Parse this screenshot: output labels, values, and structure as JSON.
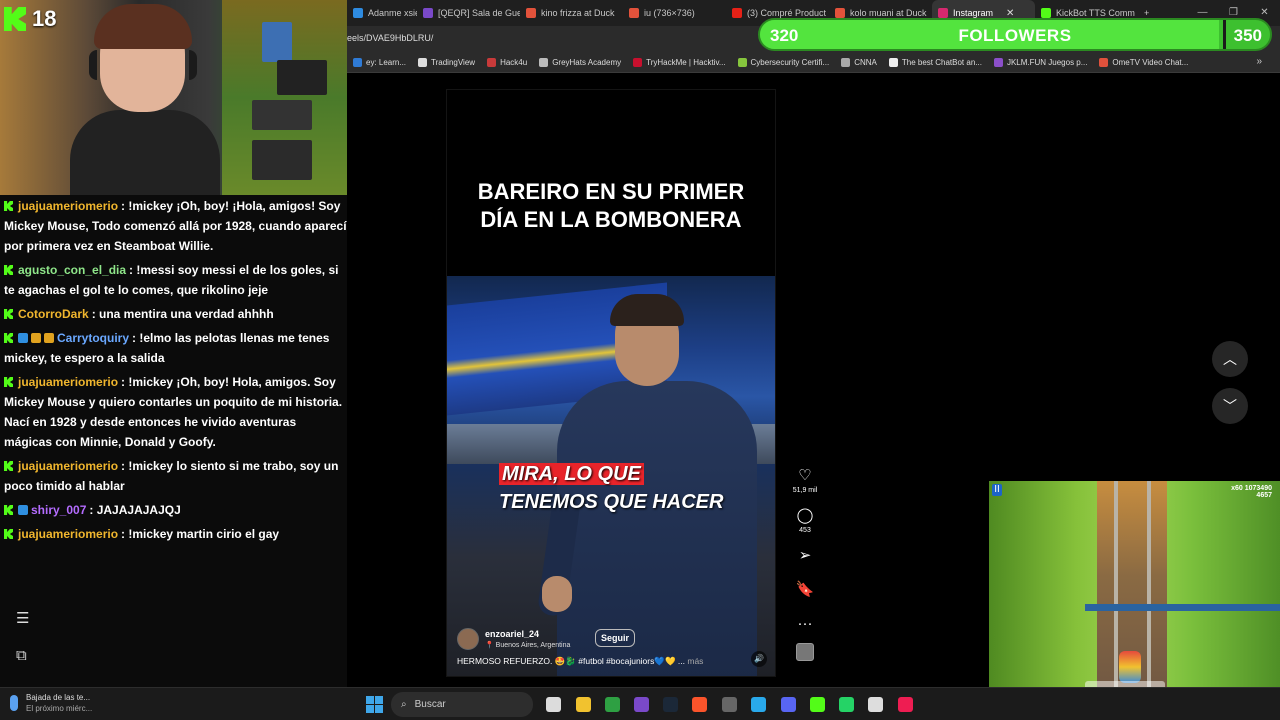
{
  "stream": {
    "viewer_count": "18",
    "followers_goal": {
      "min": "320",
      "title": "FOLLOWERS",
      "max": "350",
      "progress": 0.9
    }
  },
  "browser": {
    "tabs": [
      {
        "label": "Adanme xsiemp",
        "color": "#2e8be0",
        "active": false
      },
      {
        "label": "[QEQR] Sala de Gue",
        "color": "#7a49c9",
        "active": false
      },
      {
        "label": "kino frizza at Duck",
        "color": "#e2523b",
        "active": false
      },
      {
        "label": "iu (736×736)",
        "color": "#e2523b",
        "active": false
      },
      {
        "label": "(3) Compré Product",
        "color": "#e62117",
        "active": false
      },
      {
        "label": "kolo muani at Duck",
        "color": "#e2523b",
        "active": false
      },
      {
        "label": "Instagram",
        "color": "#d6296f",
        "active": true
      },
      {
        "label": "KickBot TTS Comm",
        "color": "#53fc18",
        "active": false
      }
    ],
    "new_tab": "+",
    "url": "eels/DVAE9HbDLRU/",
    "bookmarks": [
      {
        "label": "ey: Learn...",
        "color": "#2f7bd6"
      },
      {
        "label": "TradingView",
        "color": "#dddddd"
      },
      {
        "label": "Hack4u",
        "color": "#c83a3a"
      },
      {
        "label": "GreyHats Academy",
        "color": "#bbbbbb"
      },
      {
        "label": "TryHackMe | Hacktiv...",
        "color": "#c8102e"
      },
      {
        "label": "Cybersecurity Certifi...",
        "color": "#86c53d"
      },
      {
        "label": "CNNA",
        "color": "#aaaaaa"
      },
      {
        "label": "The best ChatBot an...",
        "color": "#eeeeee"
      },
      {
        "label": "JKLM.FUN Juegos p...",
        "color": "#8b4fc9"
      },
      {
        "label": "OmeTV Video Chat...",
        "color": "#e0513c"
      }
    ],
    "bookmarks_more": "»"
  },
  "chat": {
    "messages": [
      {
        "user": "juajuameriomerio",
        "color": "#f0b62e",
        "badges": [],
        "text": ": !mickey ¡Oh, boy! ¡Hola, amigos! Soy Mickey Mouse, Todo comenzó allá por 1928, cuando aparecí por primera vez en Steamboat Willie."
      },
      {
        "user": "agusto_con_el_dia",
        "color": "#8fe68a",
        "badges": [],
        "text": ": !messi soy messi el de los goles, si te agachas el gol te lo comes, que rikolino jeje"
      },
      {
        "user": "CotorroDark",
        "color": "#f0b62e",
        "badges": [],
        "text": ": una mentira una verdad ahhhh"
      },
      {
        "user": "Carrytoquiry",
        "color": "#6aa8ff",
        "badges": [
          "#2f8fe0",
          "#e0a21f",
          "#e0a21f"
        ],
        "text": ": !elmo las pelotas llenas me tenes mickey, te espero a la salida"
      },
      {
        "user": "juajuameriomerio",
        "color": "#f0b62e",
        "badges": [],
        "text": ": !mickey ¡Oh, boy! Hola, amigos. Soy Mickey Mouse y quiero contarles un poquito de mi historia. Nací en 1928 y desde entonces he vivido aventuras mágicas con Minnie, Donald y Goofy."
      },
      {
        "user": "juajuameriomerio",
        "color": "#f0b62e",
        "badges": [],
        "text": ": !mickey lo siento si me trabo, soy un poco timido al hablar"
      },
      {
        "user": "shiry_007",
        "color": "#b46cff",
        "badges": [
          "#2f8fe0"
        ],
        "text": ": JAJAJAJAJQJ"
      },
      {
        "user": "juajuameriomerio",
        "color": "#f0b62e",
        "badges": [],
        "text": ": !mickey martin cirio el gay"
      }
    ]
  },
  "reel": {
    "title_line1": "BAREIRO EN SU PRIMER",
    "title_line2": "DÍA EN LA BOMBONERA",
    "caption_highlight": "MIRA, LO QUE",
    "caption_line2": "TENEMOS QUE HACER",
    "author": "enzoariel_24",
    "location": "Buenos Aires, Argentina",
    "follow_label": "Seguir",
    "description": "HERMOSO REFUERZO. 🤩🐉 #futbol #bocajuniors💙💛 ...",
    "more_label": "más",
    "likes": "51,9 mil",
    "comments": "453"
  },
  "icons": {
    "like": "heart-icon",
    "comment": "comment-icon",
    "share": "send-icon",
    "save": "bookmark-icon",
    "more": "more-icon",
    "up": "chevron-up-icon",
    "down": "chevron-down-icon",
    "mute": "speaker-icon"
  },
  "game": {
    "score": "1073490",
    "coins": "4657",
    "multiplier": "x60"
  },
  "taskbar": {
    "notification_title": "Bajada de las te...",
    "notification_sub": "El próximo miérc...",
    "search_placeholder": "Buscar"
  }
}
